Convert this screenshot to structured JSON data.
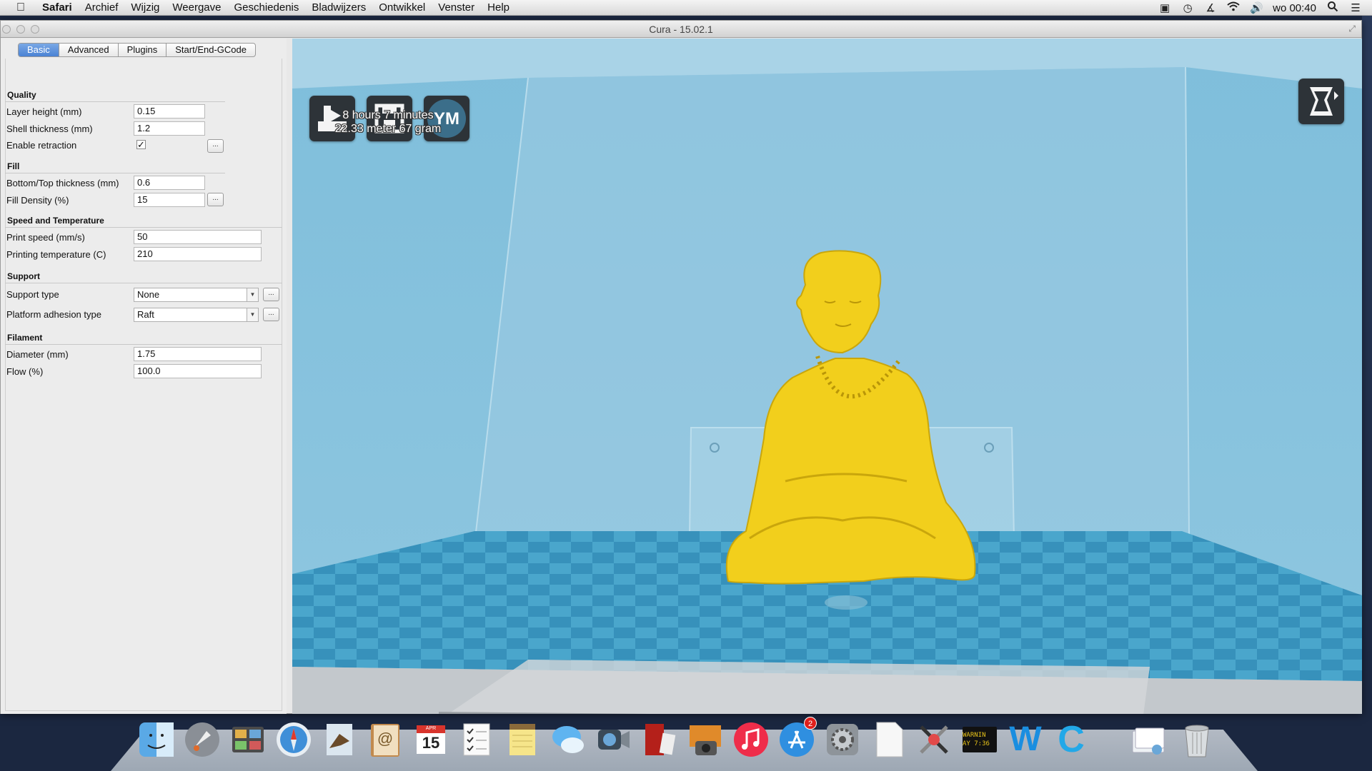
{
  "menubar": {
    "app": "Safari",
    "items": [
      "Archief",
      "Wijzig",
      "Weergave",
      "Geschiedenis",
      "Bladwijzers",
      "Ontwikkel",
      "Venster",
      "Help"
    ],
    "clock": "wo 00:40",
    "status_icons": [
      "screen-mirror-icon",
      "time-machine-icon",
      "bluetooth-icon",
      "wifi-icon",
      "volume-icon"
    ]
  },
  "window": {
    "title": "Cura - 15.02.1"
  },
  "tabs": [
    "Basic",
    "Advanced",
    "Plugins",
    "Start/End-GCode"
  ],
  "settings": {
    "quality": {
      "title": "Quality",
      "layer_height_label": "Layer height (mm)",
      "layer_height": "0.15",
      "shell_thickness_label": "Shell thickness (mm)",
      "shell_thickness": "1.2",
      "retraction_label": "Enable retraction",
      "retraction_checked": true,
      "retraction_mark": "✓"
    },
    "fill": {
      "title": "Fill",
      "bottom_top_label": "Bottom/Top thickness (mm)",
      "bottom_top": "0.6",
      "density_label": "Fill Density (%)",
      "density": "15"
    },
    "speed": {
      "title": "Speed and Temperature",
      "print_speed_label": "Print speed (mm/s)",
      "print_speed": "50",
      "temperature_label": "Printing temperature (C)",
      "temperature": "210"
    },
    "support": {
      "title": "Support",
      "support_type_label": "Support type",
      "support_type": "None",
      "adhesion_label": "Platform adhesion type",
      "adhesion": "Raft"
    },
    "filament": {
      "title": "Filament",
      "diameter_label": "Diameter (mm)",
      "diameter": "1.75",
      "flow_label": "Flow (%)",
      "flow": "100.0"
    },
    "more_button": "..."
  },
  "viewport": {
    "toolbar_icons": [
      "load-model-icon",
      "save-toolpath-icon",
      "youmagine-icon"
    ],
    "youmagine_label": "YM",
    "estimate_time": "8 hours 7 minutes",
    "estimate_material": "22.33 meter 67 gram",
    "view_mode_icon": "view-mode-icon",
    "model_color": "#f2cf1c",
    "bed_color_a": "#3f9bc2",
    "bed_color_b": "#5aafd2"
  },
  "dock": {
    "apps": [
      {
        "name": "finder",
        "label": ""
      },
      {
        "name": "launchpad",
        "label": ""
      },
      {
        "name": "photo-browser",
        "label": ""
      },
      {
        "name": "safari",
        "label": ""
      },
      {
        "name": "mail",
        "label": ""
      },
      {
        "name": "contacts",
        "label": "@"
      },
      {
        "name": "calendar",
        "label": "15",
        "sub": "APR"
      },
      {
        "name": "reminders",
        "label": ""
      },
      {
        "name": "notes",
        "label": ""
      },
      {
        "name": "messages",
        "label": ""
      },
      {
        "name": "facetime",
        "label": ""
      },
      {
        "name": "photo-booth",
        "label": ""
      },
      {
        "name": "iphoto",
        "label": ""
      },
      {
        "name": "itunes",
        "label": ""
      },
      {
        "name": "app-store",
        "label": "",
        "badge": "2"
      },
      {
        "name": "system-preferences",
        "label": ""
      },
      {
        "name": "textedit",
        "label": ""
      },
      {
        "name": "color-utility",
        "label": ""
      },
      {
        "name": "console",
        "label": "WARNIN\nAY 7:36"
      },
      {
        "name": "web-app",
        "label": "W"
      },
      {
        "name": "cura",
        "label": "C"
      },
      {
        "name": "documents",
        "label": ""
      },
      {
        "name": "trash",
        "label": ""
      }
    ]
  }
}
